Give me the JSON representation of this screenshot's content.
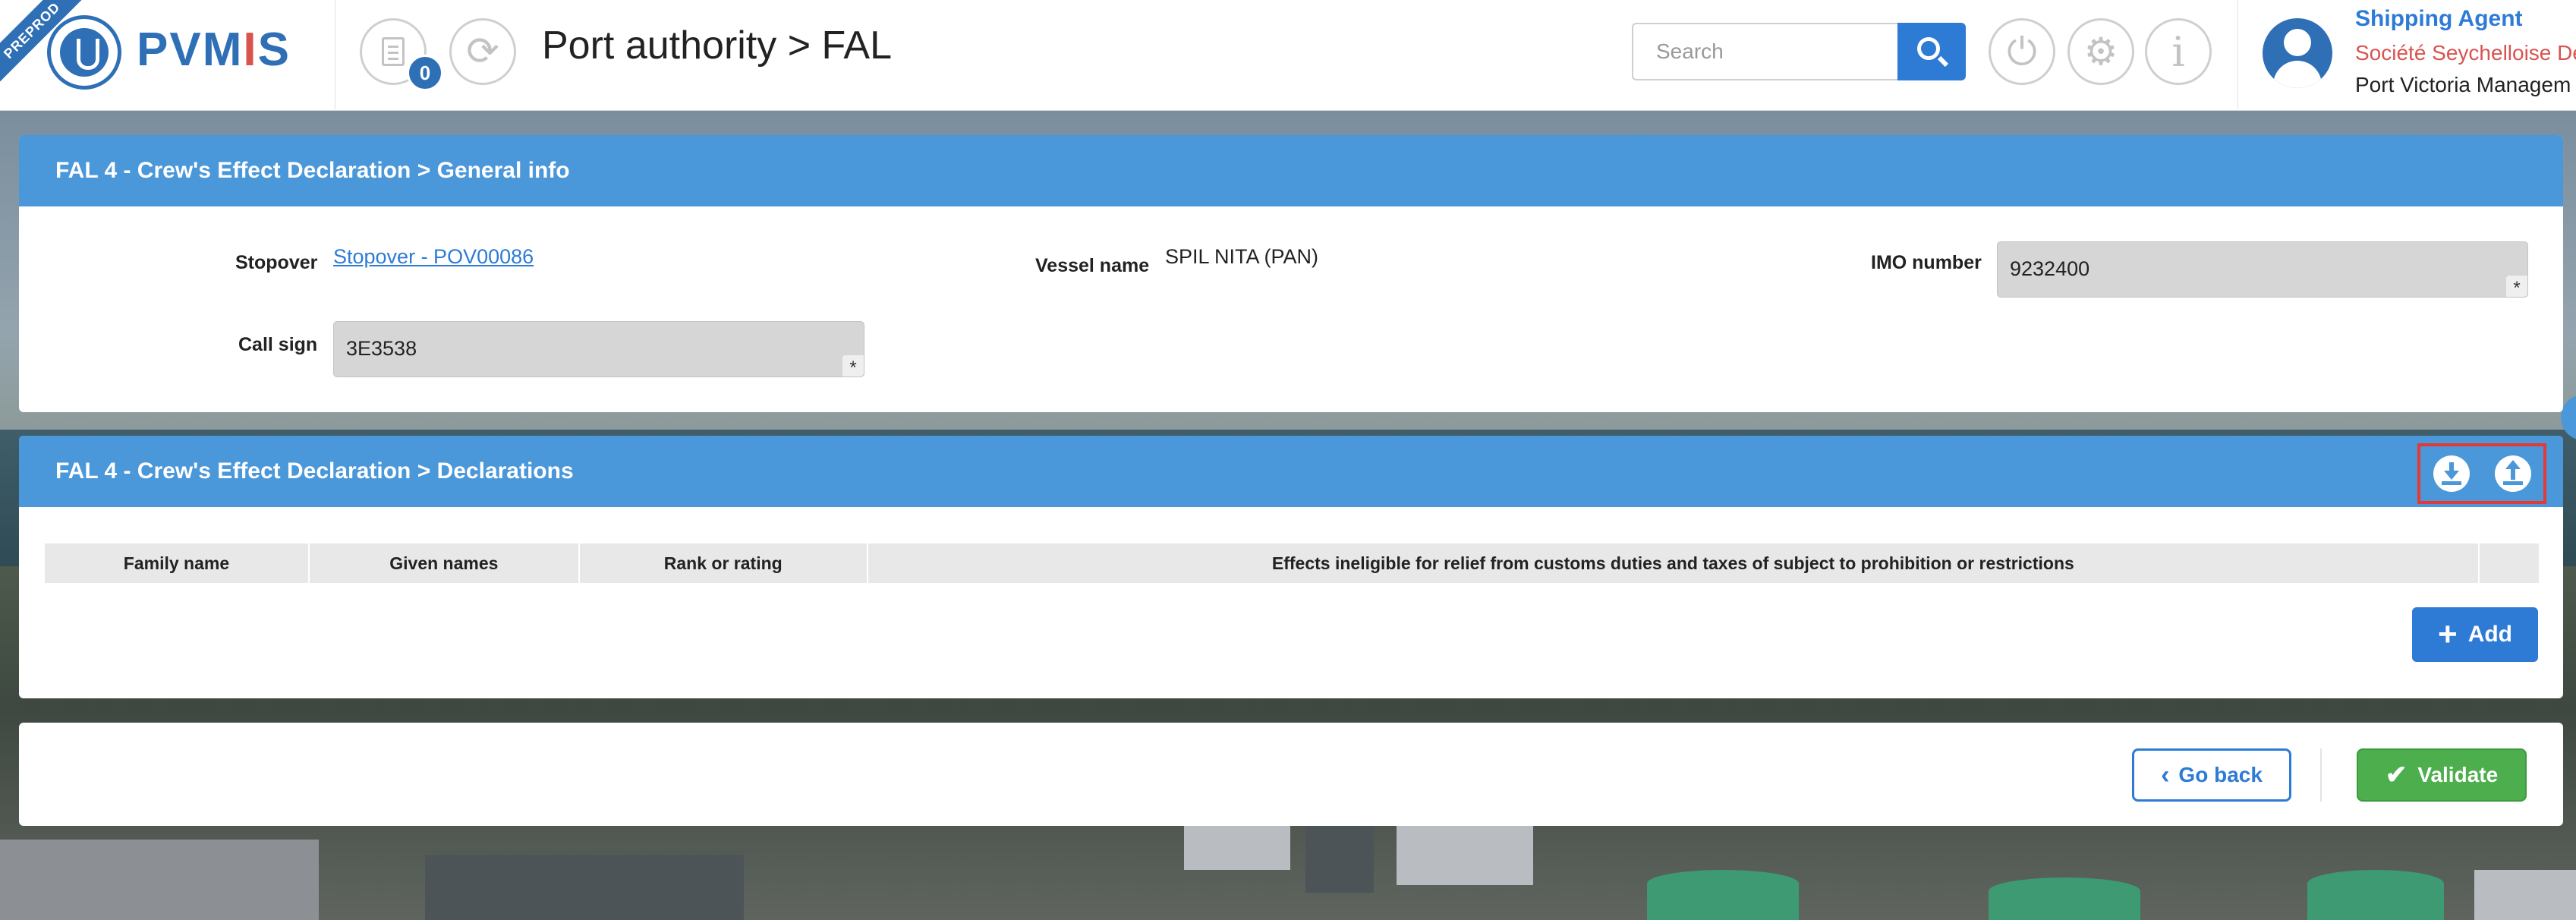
{
  "environment_badge": "PREPROD",
  "app": {
    "name_part1": "PVM",
    "name_accent": "I",
    "name_part2": "S"
  },
  "header": {
    "notifications_count": "0",
    "page_title": "Port authority > FAL",
    "search": {
      "placeholder": "Search",
      "value": ""
    },
    "icons": [
      "document-icon",
      "refresh-icon",
      "search-icon",
      "power-icon",
      "gear-icon",
      "info-icon"
    ]
  },
  "user": {
    "role": "Shipping Agent",
    "company": "Société Seychelloise De",
    "organization": "Port Victoria Managem"
  },
  "general_info": {
    "title": "FAL 4 - Crew's Effect Declaration > General info",
    "stopover_label": "Stopover",
    "stopover_value": "Stopover - POV00086",
    "vessel_label": "Vessel name",
    "vessel_value": "SPIL NITA (PAN)",
    "imo_label": "IMO number",
    "imo_value": "9232400",
    "callsign_label": "Call sign",
    "callsign_value": "3E3538",
    "required_mark": "*"
  },
  "declarations": {
    "title": "FAL 4 - Crew's Effect Declaration > Declarations",
    "columns": [
      "Family name",
      "Given names",
      "Rank or rating",
      "Effects ineligible for relief from customs duties and taxes of subject to prohibition or restrictions",
      ""
    ],
    "rows": [],
    "add_label": "Add",
    "add_icon": "+"
  },
  "footer": {
    "goback_label": "Go back",
    "goback_icon": "‹",
    "validate_label": "Validate",
    "validate_icon": "✔"
  },
  "colors": {
    "primary": "#2e7bd6",
    "panel_header": "#4a97d9",
    "success": "#4cae4c",
    "danger": "#d9534f"
  }
}
